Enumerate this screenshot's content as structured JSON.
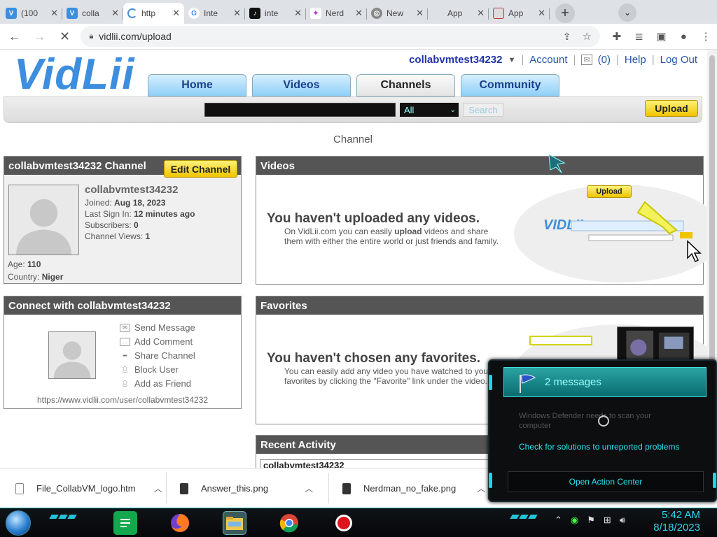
{
  "browser": {
    "tabs": [
      {
        "title": "(100",
        "icon": "vidlii-icon",
        "active": false
      },
      {
        "title": "colla",
        "icon": "vidlii-icon",
        "active": false
      },
      {
        "title": "http",
        "icon": "loading-spinner-icon",
        "active": true
      },
      {
        "title": "Inte",
        "icon": "google-icon",
        "active": false
      },
      {
        "title": "inte",
        "icon": "tiktok-icon",
        "active": false
      },
      {
        "title": "Nerd",
        "icon": "nerd-icon",
        "active": false
      },
      {
        "title": "New",
        "icon": "chrome-icon",
        "active": false
      },
      {
        "title": "App",
        "icon": "blank-icon",
        "active": false
      },
      {
        "title": "App",
        "icon": "app-icon",
        "active": false
      }
    ],
    "url": "vidlii.com/upload"
  },
  "site": {
    "logo_text": "VidLii",
    "username": "collabvmtest34232",
    "user_links": {
      "account": "Account",
      "messages": "(0)",
      "help": "Help",
      "logout": "Log Out"
    },
    "nav": {
      "home": "Home",
      "videos": "Videos",
      "channels": "Channels",
      "community": "Community"
    },
    "search": {
      "select_value": "All",
      "button": "Search"
    },
    "upload_button": "Upload",
    "page_heading": "Channel"
  },
  "channel": {
    "header": "collabvmtest34232 Channel",
    "edit_button": "Edit Channel",
    "name": "collabvmtest34232",
    "joined_label": "Joined:",
    "joined": "Aug 18, 2023",
    "lastsign_label": "Last Sign In:",
    "lastsign": "12 minutes ago",
    "subs_label": "Subscribers:",
    "subs": "0",
    "views_label": "Channel Views:",
    "views": "1",
    "age_label": "Age:",
    "age": "110",
    "country_label": "Country:",
    "country": "Niger"
  },
  "connect": {
    "header": "Connect with collabvmtest34232",
    "actions": [
      "Send Message",
      "Add Comment",
      "Share Channel",
      "Block User",
      "Add as Friend"
    ],
    "url": "https://www.vidlii.com/user/collabvmtest34232"
  },
  "videos": {
    "header": "Videos",
    "empty_title": "You haven't uploaded any videos.",
    "empty_line1_pre": "On VidLii.com you can easily ",
    "empty_line1_bold": "upload",
    "empty_line1_post": " videos and share",
    "empty_line2": "them with either the entire world or just friends and family.",
    "promo_upload": "Upload"
  },
  "favorites": {
    "header": "Favorites",
    "empty_title": "You haven't chosen any favorites.",
    "empty_line1": "You can easily add any video you have watched to your",
    "empty_line2": "favorites by clicking the \"Favorite\" link under the video."
  },
  "activity": {
    "header": "Recent Activity",
    "row": "collabvmtest34232"
  },
  "downloads": [
    {
      "name": "File_CollabVM_logo.htm",
      "type": "doc"
    },
    {
      "name": "Answer_this.png",
      "type": "img"
    },
    {
      "name": "Nerdman_no_fake.png",
      "type": "img"
    }
  ],
  "action_center": {
    "title": "2 messages",
    "defender": "Windows Defender needs to scan your computer",
    "solutions": "Check for solutions to unreported problems",
    "open": "Open Action Center"
  },
  "taskbar": {
    "time": "5:42 AM",
    "date": "8/18/2023",
    "apps": [
      "green-app-icon",
      "firefox-icon",
      "file-explorer-icon",
      "chrome-icon",
      "record-icon"
    ]
  },
  "colors": {
    "accent": "#3d8ede",
    "nav_text": "#1a3f8a",
    "upload_yellow": "#f0c400",
    "taskbar_cyan": "#31d3f0"
  }
}
